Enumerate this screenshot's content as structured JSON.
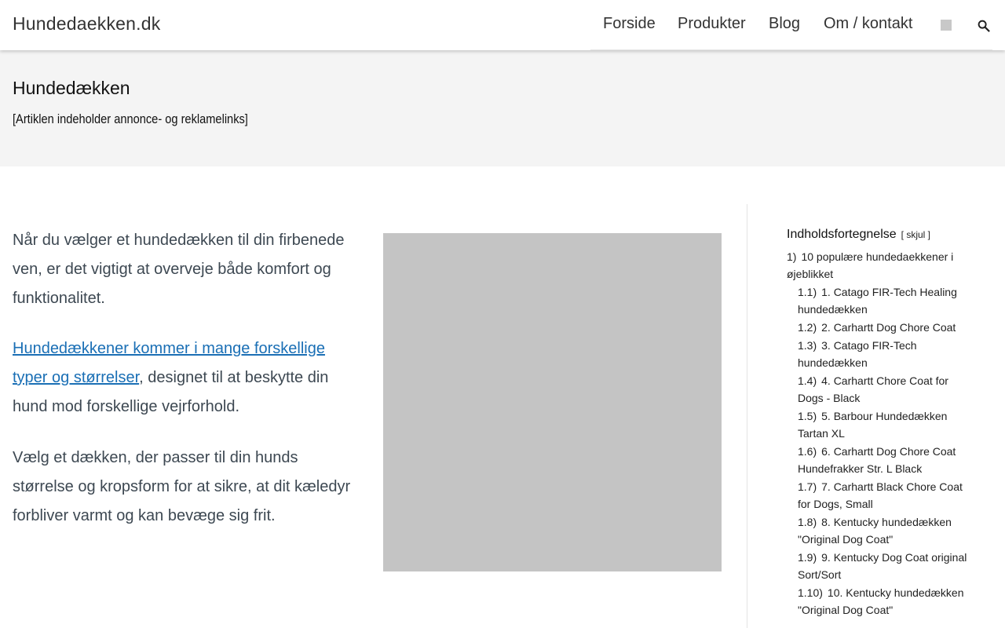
{
  "header": {
    "site_title": "Hundedaekken.dk",
    "nav": [
      "Forside",
      "Produkter",
      "Blog",
      "Om / kontakt"
    ]
  },
  "hero": {
    "title": "Hundedækken",
    "disclaimer": "[Artiklen indeholder annonce- og reklamelinks]"
  },
  "article": {
    "p1": "Når du vælger et hundedækken til din firbenede ven, er det vigtigt at overveje både komfort og funktionalitet.",
    "p2_link": "Hundedækkener kommer i mange forskellige typer og størrelser",
    "p2_rest": ", designet til at beskytte din hund mod forskellige vejrforhold.",
    "p3": "Vælg et dækken, der passer til din hunds størrelse og kropsform for at sikre, at dit kæledyr forbliver varmt og kan bevæge sig frit."
  },
  "toc": {
    "title": "Indholdsfortegnelse",
    "toggle": "[ skjul ]",
    "items": [
      {
        "num": "1)",
        "text": "10 populære hundedaekkener i øjeblikket",
        "level": 1
      },
      {
        "num": "1.1)",
        "text": "1. Catago FIR-Tech Healing hundedækken",
        "level": 2
      },
      {
        "num": "1.2)",
        "text": "2. Carhartt Dog Chore Coat",
        "level": 2
      },
      {
        "num": "1.3)",
        "text": "3. Catago FIR-Tech hundedækken",
        "level": 2
      },
      {
        "num": "1.4)",
        "text": "4. Carhartt Chore Coat for Dogs - Black",
        "level": 2
      },
      {
        "num": "1.5)",
        "text": "5. Barbour Hundedækken Tartan XL",
        "level": 2
      },
      {
        "num": "1.6)",
        "text": "6. Carhartt Dog Chore Coat Hundefrakker Str. L Black",
        "level": 2
      },
      {
        "num": "1.7)",
        "text": "7. Carhartt Black Chore Coat for Dogs, Small",
        "level": 2
      },
      {
        "num": "1.8)",
        "text": "8. Kentucky hundedækken \"Original Dog Coat\"",
        "level": 2
      },
      {
        "num": "1.9)",
        "text": "9. Kentucky Dog Coat original Sort/Sort",
        "level": 2
      },
      {
        "num": "1.10)",
        "text": "10. Kentucky hundedækken \"Original Dog Coat\"",
        "level": 2
      }
    ]
  },
  "icons": {
    "search": "search-icon",
    "square": "placeholder-square-icon"
  },
  "colors": {
    "link": "#1a6fb5",
    "hero_bg": "#f4f4f4",
    "image_placeholder": "#c4c4c4"
  }
}
